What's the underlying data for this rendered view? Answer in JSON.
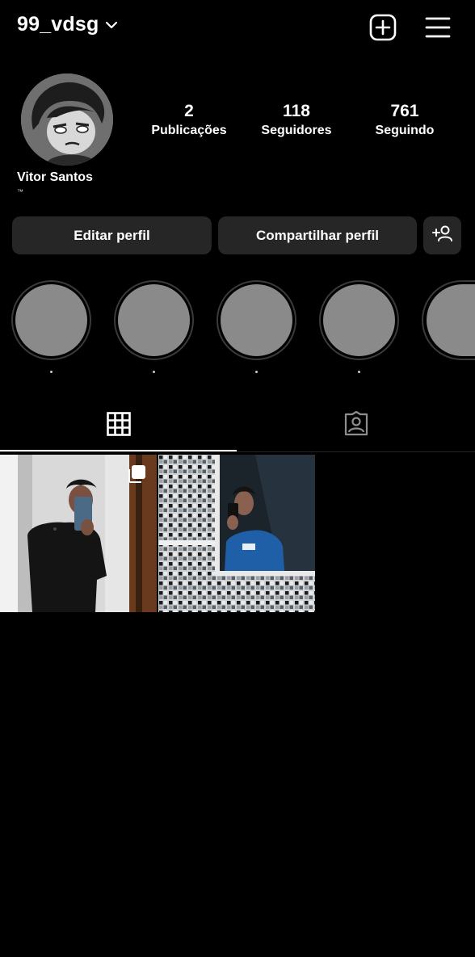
{
  "header": {
    "username": "99_vdsg",
    "icons": {
      "switch": "chevron-down-icon",
      "create": "add-post-icon",
      "menu": "hamburger-menu-icon"
    }
  },
  "profile": {
    "full_name": "Vitor Santos",
    "bio": "™",
    "stats": [
      {
        "value": "2",
        "label": "Publicações"
      },
      {
        "value": "118",
        "label": "Seguidores"
      },
      {
        "value": "761",
        "label": "Seguindo"
      }
    ]
  },
  "actions": {
    "edit_label": "Editar perfil",
    "share_label": "Compartilhar perfil",
    "discover_icon": "add-person-icon"
  },
  "highlights": [
    {
      "label": "."
    },
    {
      "label": "."
    },
    {
      "label": "."
    },
    {
      "label": "."
    },
    {
      "label": "."
    }
  ],
  "tabs": [
    {
      "icon": "grid-icon",
      "active": true
    },
    {
      "icon": "tagged-icon",
      "active": false
    }
  ],
  "posts": [
    {
      "type": "carousel",
      "icon": "multiple-photos-icon"
    },
    {
      "type": "photo"
    }
  ],
  "colors": {
    "background": "#000000",
    "button": "#262626",
    "text": "#ffffff",
    "highlight_fill": "#8a8a8a"
  }
}
